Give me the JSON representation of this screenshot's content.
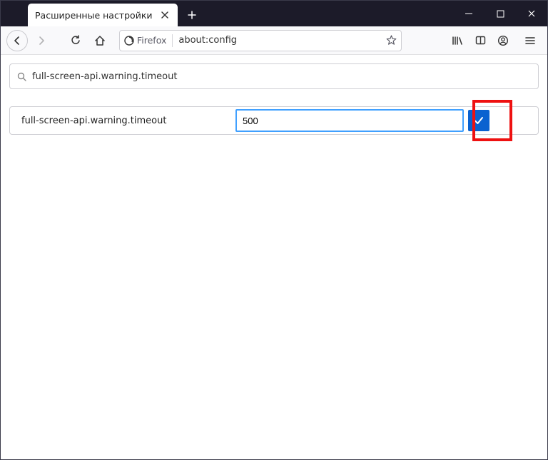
{
  "tab": {
    "title": "Расширенные настройки"
  },
  "urlbar": {
    "identity": "Firefox",
    "url": "about:config"
  },
  "config": {
    "search_value": "full-screen-api.warning.timeout",
    "pref": {
      "name": "full-screen-api.warning.timeout",
      "value": "500"
    }
  },
  "colors": {
    "accent": "#0a62d0",
    "highlight": "#e11111"
  }
}
